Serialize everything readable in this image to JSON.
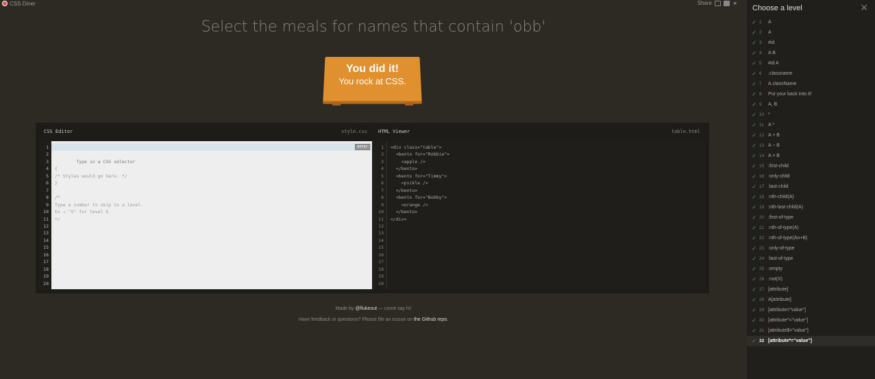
{
  "app": {
    "logo_label": "CSS Diner",
    "share_label": "Share"
  },
  "order": "Select the meals for names that contain 'obb'",
  "sign": {
    "line1": "You did it!",
    "line2": "You rock at CSS."
  },
  "css_editor": {
    "title": "CSS Editor",
    "file": "style.css",
    "placeholder": "Type in a CSS selector",
    "enter_label": "enter",
    "line_numbers": "1\n2\n3\n4\n5\n6\n7\n8\n9\n10\n11\n12\n13\n14\n15\n16\n17\n18\n19\n20",
    "code": "\n{\n/* Styles would go here. */\n}\n\n/*\nType a number to skip to a level.\nEx → \"5\" for level 5\n*/"
  },
  "html_viewer": {
    "title": "HTML Viewer",
    "file": "table.html",
    "line_numbers": "1\n2\n3\n4\n5\n6\n7\n8\n9\n10\n11\n12\n13\n14\n15\n16\n17\n18\n19\n20",
    "code": "<div class=\"table\">\n  <bento for=\"Robbie\">\n    <apple />\n  </bento>\n  <bento for=\"Timmy\">\n    <pickle />\n  </bento>\n  <bento for=\"Bobby\">\n    <orange />\n  </bento>\n</div>"
  },
  "footer": {
    "made_by": "Made by",
    "author": "@flukeout",
    "made_by_suffix": "— come say hi!",
    "feedback": "Have feedback or questions? Please file an isssue on",
    "repo": "the Github repo."
  },
  "sidebar": {
    "title": "Choose a level",
    "levels": [
      {
        "num": "1",
        "name": "A"
      },
      {
        "num": "2",
        "name": "A"
      },
      {
        "num": "3",
        "name": "#id"
      },
      {
        "num": "4",
        "name": "A B"
      },
      {
        "num": "5",
        "name": "#id A"
      },
      {
        "num": "6",
        "name": ".classname"
      },
      {
        "num": "7",
        "name": "A.className"
      },
      {
        "num": "8",
        "name": "Put your back into it!"
      },
      {
        "num": "9",
        "name": "A, B"
      },
      {
        "num": "10",
        "name": "*"
      },
      {
        "num": "11",
        "name": "A *"
      },
      {
        "num": "12",
        "name": "A + B"
      },
      {
        "num": "13",
        "name": "A ~ B"
      },
      {
        "num": "14",
        "name": "A > B"
      },
      {
        "num": "15",
        "name": ":first-child"
      },
      {
        "num": "16",
        "name": ":only-child"
      },
      {
        "num": "17",
        "name": ":last-child"
      },
      {
        "num": "18",
        "name": ":nth-child(A)"
      },
      {
        "num": "19",
        "name": ":nth-last-child(A)"
      },
      {
        "num": "20",
        "name": ":first-of-type"
      },
      {
        "num": "21",
        "name": ":nth-of-type(A)"
      },
      {
        "num": "22",
        "name": ":nth-of-type(An+B)"
      },
      {
        "num": "23",
        "name": ":only-of-type"
      },
      {
        "num": "24",
        "name": ":last-of-type"
      },
      {
        "num": "25",
        "name": ":empty"
      },
      {
        "num": "26",
        "name": ":not(X)"
      },
      {
        "num": "27",
        "name": "[attribute]"
      },
      {
        "num": "28",
        "name": "A[attribute]"
      },
      {
        "num": "29",
        "name": "[attribute=\"value\"]"
      },
      {
        "num": "30",
        "name": "[attribute^=\"value\"]"
      },
      {
        "num": "31",
        "name": "[attribute$=\"value\"]"
      },
      {
        "num": "32",
        "name": "[attribute*=\"value\"]"
      }
    ],
    "current_level": "32",
    "check_color": "#5a9e5a"
  }
}
